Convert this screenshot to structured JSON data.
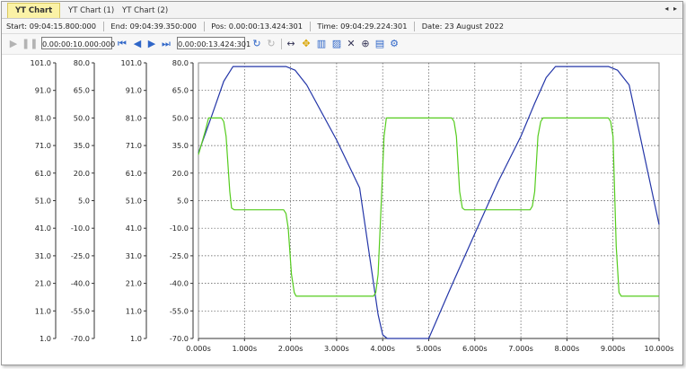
{
  "tabs": [
    {
      "label": "YT Chart",
      "active": true
    },
    {
      "label": "YT Chart (1)",
      "active": false
    },
    {
      "label": "YT Chart (2)",
      "active": false
    }
  ],
  "nav": {
    "prev": "◂",
    "next": "▸"
  },
  "info": {
    "start_label": "Start:",
    "start_value": "09:04:15.800:000",
    "end_label": "End:",
    "end_value": "09:04:39.350:000",
    "pos_label": "Pos:",
    "pos_value": "0.00:00:13.424:301",
    "time_label": "Time:",
    "time_value": "09:04:29.224:301",
    "date_label": "Date:",
    "date_value": "23 August 2022"
  },
  "toolbar": {
    "span_value": "0.00:00:10.000:000",
    "position_value": "0.00:00:13.424:301",
    "icons": [
      "play-icon",
      "pause-icon",
      "first-icon",
      "prev-icon",
      "next-icon",
      "last-icon",
      "refresh-icon",
      "reset-icon",
      "pan-icon",
      "move-icon",
      "axis-icon",
      "graph-icon",
      "cross-icon",
      "zoom-icon",
      "export-icon",
      "settings-icon"
    ]
  },
  "chart_data": {
    "type": "line",
    "x_ticks": [
      "0.000s",
      "1.000s",
      "2.000s",
      "3.000s",
      "4.000s",
      "5.000s",
      "6.000s",
      "7.000s",
      "8.000s",
      "9.000s",
      "10.000s"
    ],
    "xlim": [
      0,
      10
    ],
    "grid": true,
    "y_axes": [
      {
        "ticks": [
          "101.0",
          "91.0",
          "81.0",
          "71.0",
          "61.0",
          "51.0",
          "41.0",
          "31.0",
          "21.0",
          "11.0",
          "1.0"
        ],
        "ylim": [
          1,
          101
        ]
      },
      {
        "ticks": [
          "80.0",
          "65.0",
          "50.0",
          "35.0",
          "20.0",
          "5.0",
          "-10.0",
          "-25.0",
          "-40.0",
          "-55.0",
          "-70.0"
        ],
        "ylim": [
          -70,
          80
        ]
      },
      {
        "ticks": [
          "101.0",
          "91.0",
          "81.0",
          "71.0",
          "61.0",
          "51.0",
          "41.0",
          "31.0",
          "21.0",
          "11.0",
          "1.0"
        ],
        "ylim": [
          1,
          101
        ]
      },
      {
        "ticks": [
          "80.0",
          "65.0",
          "50.0",
          "35.0",
          "20.0",
          "5.0",
          "-10.0",
          "-25.0",
          "-40.0",
          "-55.0",
          "-70.0"
        ],
        "ylim": [
          -70,
          80
        ]
      }
    ],
    "series": [
      {
        "color": "#2436a8",
        "x": [
          0,
          0.3,
          0.55,
          0.75,
          1.0,
          1.9,
          2.1,
          2.35,
          3.0,
          3.5,
          3.9,
          4.0,
          4.1,
          4.3,
          4.5,
          5.0,
          5.5,
          6.0,
          6.5,
          7.0,
          7.3,
          7.55,
          7.75,
          8.0,
          8.9,
          9.1,
          9.35,
          10.0
        ],
        "y": [
          31,
          52,
          70,
          78,
          78,
          78,
          76,
          68,
          38,
          12,
          -57,
          -68,
          -70,
          -70,
          -70,
          -70,
          -41,
          -13,
          15,
          40,
          58,
          72,
          78,
          78,
          78,
          76,
          68,
          -8
        ]
      },
      {
        "color": "#55cc1e",
        "x": [
          0,
          0.15,
          0.22,
          0.5,
          0.55,
          0.6,
          0.68,
          0.72,
          0.78,
          1.85,
          1.9,
          1.95,
          2.02,
          2.08,
          2.12,
          3.8,
          3.85,
          3.9,
          3.97,
          4.03,
          4.08,
          5.5,
          5.55,
          5.6,
          5.67,
          5.73,
          5.78,
          7.2,
          7.25,
          7.3,
          7.37,
          7.43,
          7.48,
          8.9,
          8.95,
          9.0,
          9.07,
          9.13,
          9.18,
          10.0
        ],
        "y": [
          30,
          43,
          50,
          50,
          48,
          40,
          10,
          1,
          0,
          0,
          -2,
          -10,
          -35,
          -45,
          -47,
          -47,
          -45,
          -35,
          5,
          40,
          50,
          50,
          48,
          40,
          10,
          1,
          0,
          0,
          2,
          10,
          40,
          48,
          50,
          50,
          48,
          40,
          -20,
          -45,
          -47,
          -47
        ]
      }
    ]
  }
}
